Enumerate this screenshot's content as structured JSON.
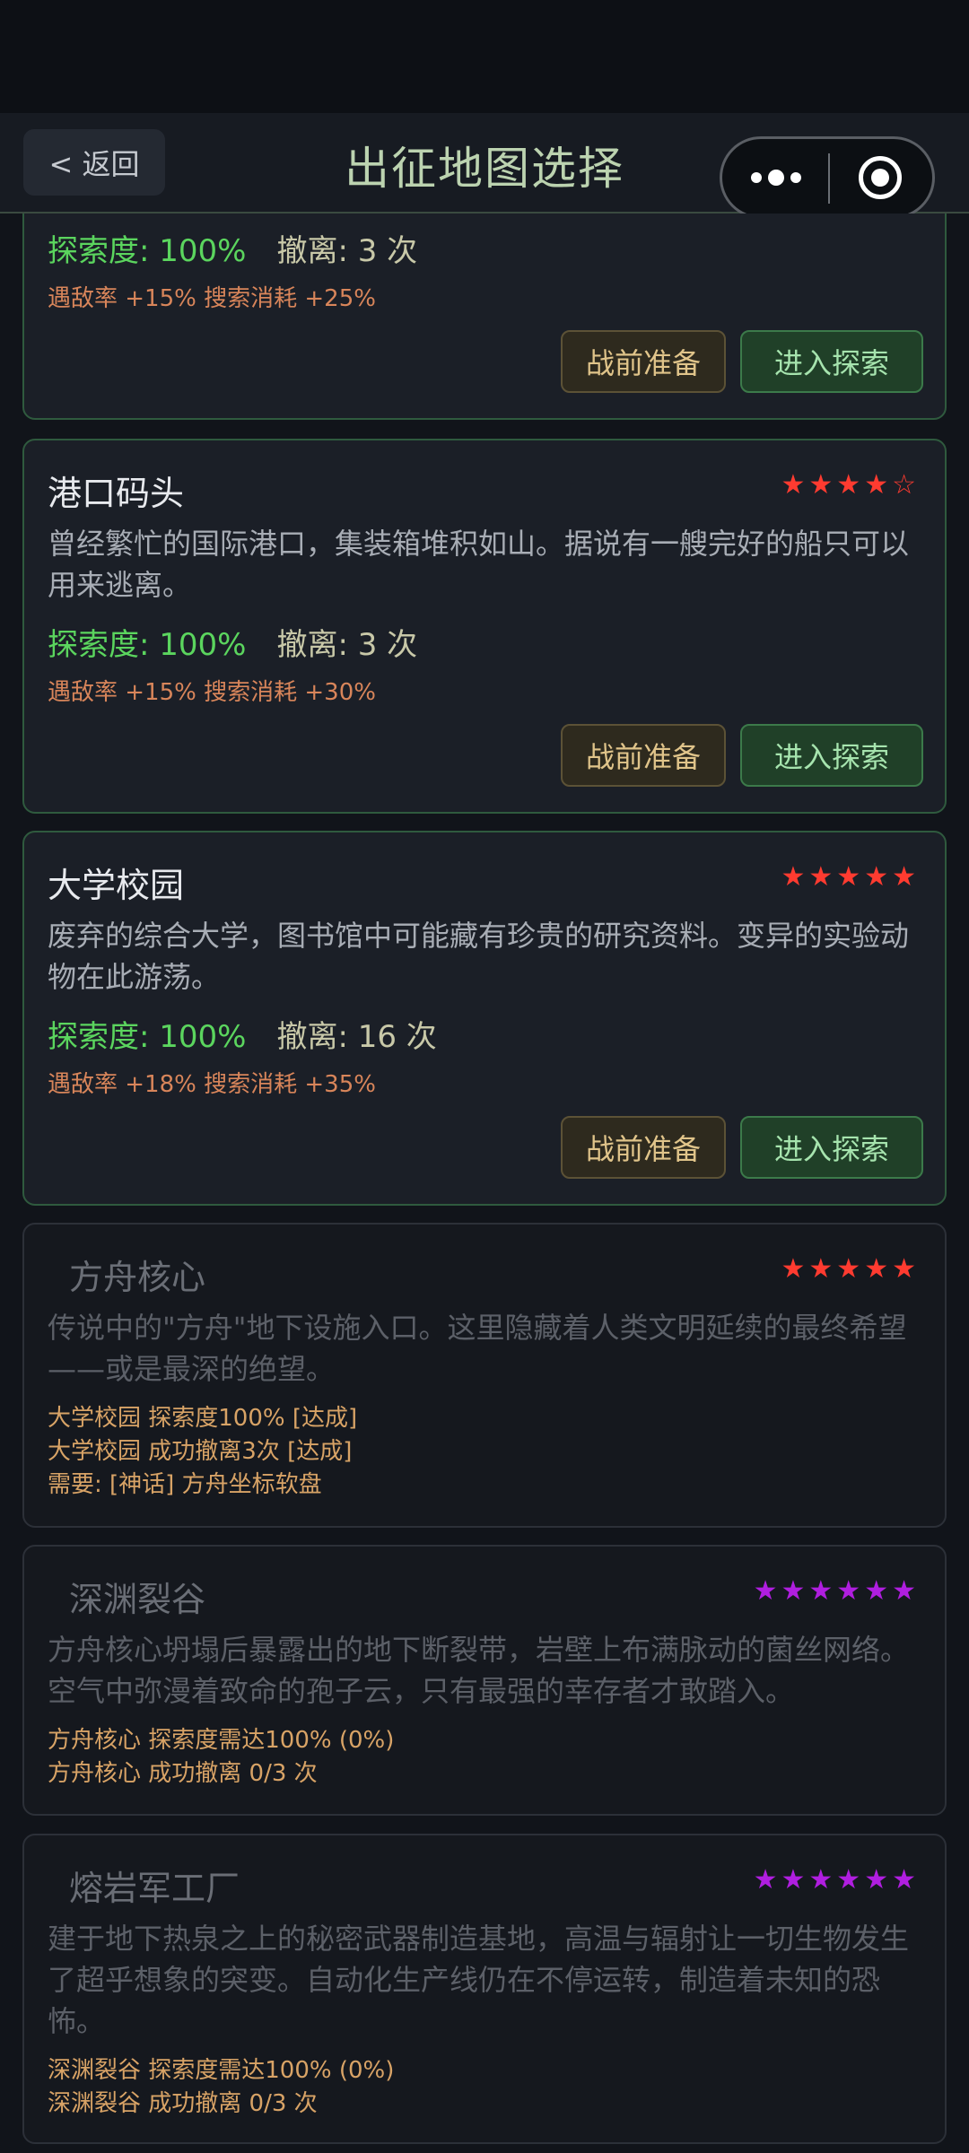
{
  "nav": {
    "back_label": "< 返回",
    "title": "出征地图选择"
  },
  "buttons": {
    "prep": "战前准备",
    "enter": "进入探索"
  },
  "maps": [
    {
      "name": "",
      "explore": "探索度: 100%",
      "extract": "撤离: 3 次",
      "mods": "遇敌率 +15%  搜索消耗 +25%"
    },
    {
      "name": "港口码头",
      "stars": "★★★★☆",
      "desc": "曾经繁忙的国际港口，集装箱堆积如山。据说有一艘完好的船只可以用来逃离。",
      "explore": "探索度: 100%",
      "extract": "撤离: 3 次",
      "mods": "遇敌率 +15%  搜索消耗 +30%"
    },
    {
      "name": "大学校园",
      "stars": "★★★★★",
      "desc": "废弃的综合大学，图书馆中可能藏有珍贵的研究资料。变异的实验动物在此游荡。",
      "explore": "探索度: 100%",
      "extract": "撤离: 16 次",
      "mods": "遇敌率 +18%  搜索消耗 +35%"
    }
  ],
  "locked_maps": [
    {
      "name": "方舟核心",
      "stars": "★★★★★",
      "star_color": "#ff3b30",
      "desc": "传说中的\"方舟\"地下设施入口。这里隐藏着人类文明延续的最终希望——或是最深的绝望。",
      "requirements": [
        "大学校园 探索度100% [达成]",
        "大学校园 成功撤离3次 [达成]",
        "需要: [神话] 方舟坐标软盘"
      ]
    },
    {
      "name": "深渊裂谷",
      "stars": "★★★★★★",
      "star_color": "#b01ee0",
      "desc": "方舟核心坍塌后暴露出的地下断裂带，岩壁上布满脉动的菌丝网络。空气中弥漫着致命的孢子云，只有最强的幸存者才敢踏入。",
      "requirements": [
        "方舟核心 探索度需达100% (0%)",
        "方舟核心 成功撤离 0/3 次"
      ]
    },
    {
      "name": "熔岩军工厂",
      "stars": "★★★★★★",
      "star_color": "#b01ee0",
      "desc": "建于地下热泉之上的秘密武器制造基地，高温与辐射让一切生物发生了超乎想象的突变。自动化生产线仍在不停运转，制造着未知的恐怖。",
      "requirements": [
        "深渊裂谷 探索度需达100% (0%)",
        "深渊裂谷 成功撤离 0/3 次"
      ]
    }
  ]
}
